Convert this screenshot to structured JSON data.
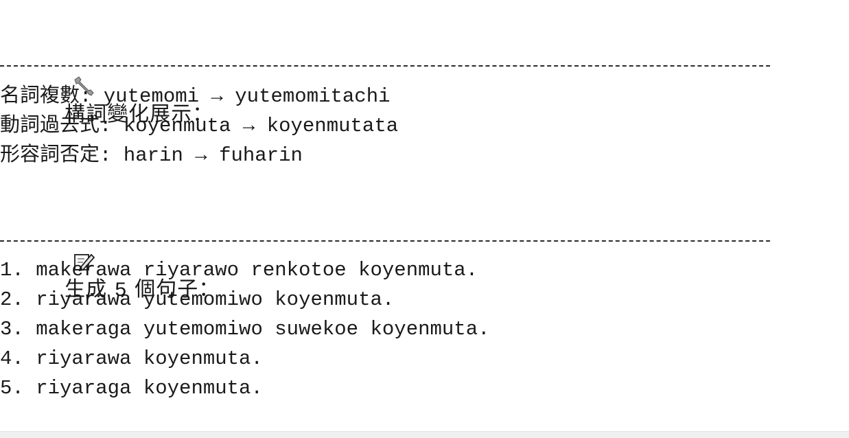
{
  "section1": {
    "icon": "wrench-icon",
    "title": "構詞變化展示："
  },
  "morphology": [
    {
      "label": "名詞複數",
      "colon": ": ",
      "base": "yutemomi",
      "arrow": " → ",
      "result": "yutemomitachi"
    },
    {
      "label": "動詞過去式",
      "colon": ": ",
      "base": "koyenmuta",
      "arrow": " → ",
      "result": "koyenmutata"
    },
    {
      "label": "形容詞否定",
      "colon": ": ",
      "base": "harin",
      "arrow": " → ",
      "result": "fuharin"
    }
  ],
  "section2": {
    "icon": "memo-icon",
    "title_prefix": "生成",
    "count": "5",
    "title_suffix": "個句子："
  },
  "sentences": [
    "1. makerawa riyarawo renkotoe koyenmuta.",
    "2. riyarawa yutemomiwo koyenmuta.",
    "3. makeraga yutemomiwo suwekoe koyenmuta.",
    "4. riyarawa koyenmuta.",
    "5. riyaraga koyenmuta."
  ]
}
